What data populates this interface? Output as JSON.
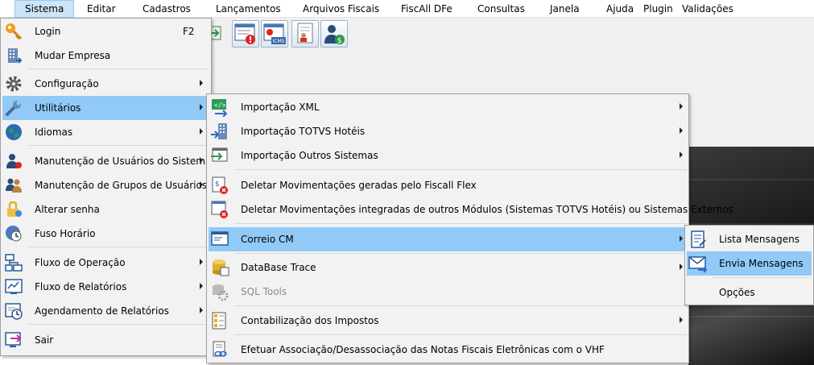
{
  "menubar": {
    "items": [
      "Sistema",
      "Editar",
      "Cadastros",
      "Lançamentos",
      "Arquivos Fiscais",
      "FiscAll DFe",
      "Consultas",
      "Janela",
      "Ajuda",
      "Plugin",
      "Validações"
    ]
  },
  "sistema_menu": {
    "items": [
      {
        "label": "Login",
        "shortcut": "F2",
        "icon": "key-icon"
      },
      {
        "label": "Mudar Empresa",
        "icon": "building-icon"
      },
      {
        "label": "Configuração",
        "icon": "gear-icon"
      },
      {
        "label": "Utilitários",
        "icon": "wrench-icon"
      },
      {
        "label": "Idiomas",
        "icon": "globe-icon"
      },
      {
        "label": "Manutenção de Usuários do Sistema",
        "icon": "user-icon"
      },
      {
        "label": "Manutenção de Grupos de Usuários",
        "icon": "users-icon"
      },
      {
        "label": "Alterar senha",
        "icon": "lock-icon"
      },
      {
        "label": "Fuso Horário",
        "icon": "clock-globe-icon"
      },
      {
        "label": "Fluxo de Operação",
        "icon": "flowchart-icon"
      },
      {
        "label": "Fluxo de Relatórios",
        "icon": "report-flow-icon"
      },
      {
        "label": "Agendamento de Relatórios",
        "icon": "schedule-icon"
      },
      {
        "label": "Sair",
        "icon": "exit-icon"
      }
    ]
  },
  "utilitarios_menu": {
    "items": [
      {
        "label": "Importação XML",
        "icon": "xml-import-icon"
      },
      {
        "label": "Importação TOTVS Hotéis",
        "icon": "hotel-import-icon"
      },
      {
        "label": "Importação Outros Sistemas",
        "icon": "window-import-icon"
      },
      {
        "label": "Deletar Movimentações geradas pelo Fiscall Flex",
        "icon": "delete-doc-icon"
      },
      {
        "label": "Deletar Movimentações integradas de outros Módulos (Sistemas TOTVS Hotéis) ou Sistemas Externos",
        "icon": "delete-window-icon"
      },
      {
        "label": "Correio CM",
        "icon": "mail-window-icon"
      },
      {
        "label": "DataBase Trace",
        "icon": "database-icon"
      },
      {
        "label": "SQL Tools",
        "icon": "sql-gear-icon"
      },
      {
        "label": "Contabilização dos Impostos",
        "icon": "accounting-icon"
      },
      {
        "label": "Efetuar Associação/Desassociação das Notas Fiscais Eletrônicas com o VHF",
        "icon": "link-doc-icon"
      }
    ]
  },
  "correio_menu": {
    "items": [
      {
        "label": "Lista Mensagens",
        "icon": "message-list-icon"
      },
      {
        "label": "Envia Mensagens",
        "icon": "send-mail-icon"
      },
      {
        "label": "Opções"
      }
    ]
  },
  "colors": {
    "highlight": "#91c9f7",
    "menubar_active": "#cce4f7",
    "menu_bg": "#f2f2f2"
  }
}
